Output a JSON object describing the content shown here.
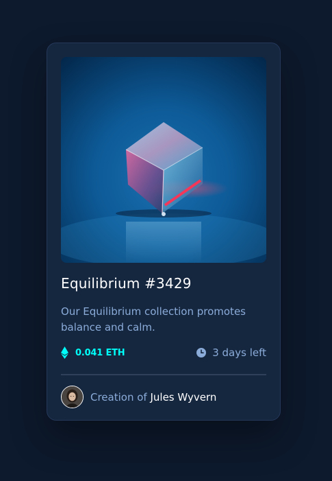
{
  "card": {
    "image_alt": "Equilibrium",
    "title": "Equilibrium #3429",
    "description": "Our Equilibrium collection promotes balance and calm.",
    "price": "0.041 ETH",
    "time_left": "3 days left",
    "creator_prefix": "Creation of ",
    "creator_name": "Jules Wyvern"
  },
  "colors": {
    "page_background": "#0d192c",
    "card_background": "#15263f",
    "accent_cyan": "#00fff8",
    "soft_blue": "#8bacd9",
    "white": "#ffffff",
    "divider": "#2e405a"
  },
  "icons": {
    "price": "ethereum-icon",
    "time": "clock-icon"
  }
}
